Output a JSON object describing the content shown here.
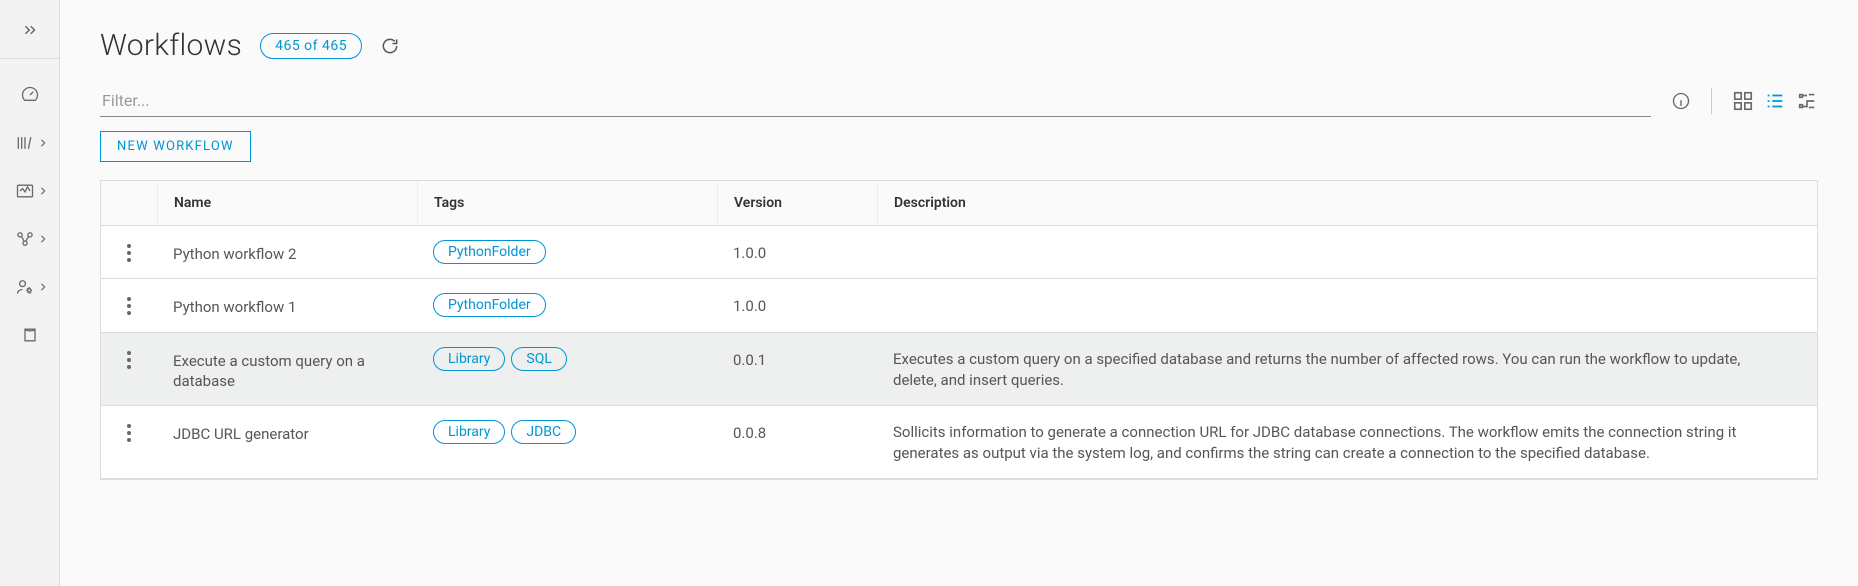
{
  "header": {
    "title": "Workflows",
    "count_badge": "465 of 465"
  },
  "filter": {
    "placeholder": "Filter..."
  },
  "buttons": {
    "new_workflow": "NEW WORKFLOW"
  },
  "table": {
    "columns": {
      "name": "Name",
      "tags": "Tags",
      "version": "Version",
      "description": "Description"
    },
    "rows": [
      {
        "name": "Python workflow 2",
        "tags": [
          "PythonFolder"
        ],
        "version": "1.0.0",
        "description": "",
        "selected": false
      },
      {
        "name": "Python workflow 1",
        "tags": [
          "PythonFolder"
        ],
        "version": "1.0.0",
        "description": "",
        "selected": false
      },
      {
        "name": "Execute a custom query on a database",
        "tags": [
          "Library",
          "SQL"
        ],
        "version": "0.0.1",
        "description": "Executes a custom query on a specified database and returns the number of affected rows. You can run the workflow to update, delete, and insert queries.",
        "selected": true
      },
      {
        "name": "JDBC URL generator",
        "tags": [
          "Library",
          "JDBC"
        ],
        "version": "0.0.8",
        "description": "Sollicits information to generate a connection URL for JDBC database connections. The workflow emits the connection string it generates as output via the system log, and confirms the string can create a connection to the specified database.",
        "selected": false
      }
    ]
  }
}
